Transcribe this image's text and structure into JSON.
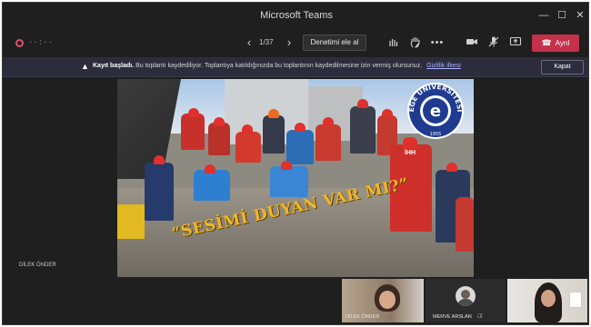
{
  "window": {
    "title": "Microsoft Teams"
  },
  "toolbar": {
    "timer": "--:--",
    "page_count": "1/37",
    "take_control_label": "Denetimi ele al",
    "leave_label": "Ayrıl"
  },
  "banner": {
    "strong": "Kayıt başladı.",
    "message": "Bu toplantı kaydediliyor. Toplantıya katıldığınızda bu toplantının kaydedilmesine izin vermiş olursunuz.",
    "link": "Gizlilik ilkesi",
    "close_label": "Kapat"
  },
  "shared_content": {
    "slogan": "“SESİMİ DUYAN VAR MI?”",
    "logo_text": "EGE ÜNİVERSİTESİ",
    "logo_year": "1955",
    "logo_letter": "e",
    "vest_text": "İHH"
  },
  "presenter_name": "DİLEK ÖNDER",
  "participants": [
    {
      "name": "DİLEK ÖNDER"
    },
    {
      "name": "MERVE ARSLAN"
    },
    {
      "name": ""
    }
  ],
  "colors": {
    "accent": "#c4314b",
    "banner_bg": "#2d2c3c",
    "link": "#a9b3ff"
  }
}
